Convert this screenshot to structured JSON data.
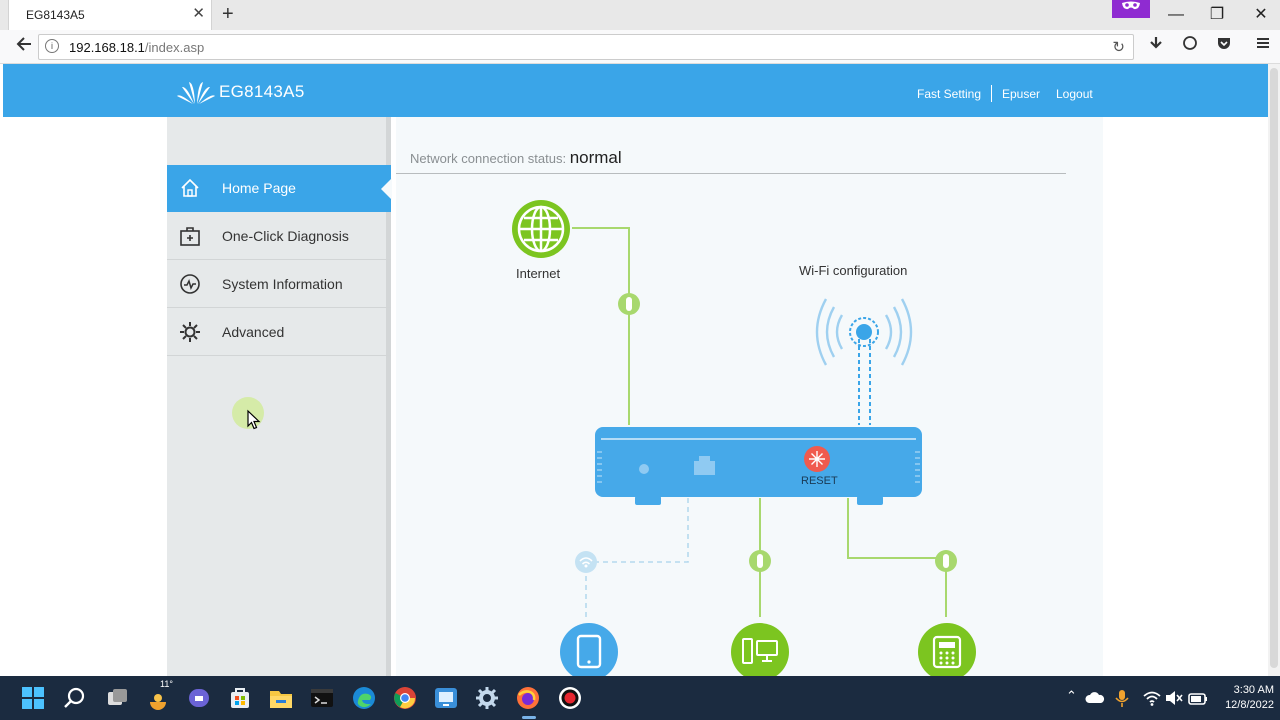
{
  "browser": {
    "tab_title": "EG8143A5",
    "tab_close": "✕",
    "new_tab": "+",
    "url_host": "192.168.18.1",
    "url_path": "/index.asp",
    "private_icon": "mask-icon"
  },
  "header": {
    "brand": "EG8143A5",
    "links": {
      "fast_setting": "Fast Setting",
      "user": "Epuser",
      "logout": "Logout"
    }
  },
  "sidebar": {
    "items": [
      {
        "label": "Home Page",
        "icon": "home-icon",
        "active": true
      },
      {
        "label": "One-Click Diagnosis",
        "icon": "medkit-icon",
        "active": false
      },
      {
        "label": "System Information",
        "icon": "pulse-icon",
        "active": false
      },
      {
        "label": "Advanced",
        "icon": "gear-icon",
        "active": false
      }
    ]
  },
  "main": {
    "status_label": "Network connection status:",
    "status_value": "normal",
    "internet_label": "Internet",
    "wifi_label": "Wi-Fi configuration",
    "reset_label": "RESET"
  },
  "colors": {
    "accent_blue": "#3aa5e8",
    "green": "#7cc520",
    "reset_red": "#f05a4e"
  },
  "taskbar": {
    "time": "3:30 AM",
    "date": "12/8/2022",
    "weather_badge": "11°"
  }
}
